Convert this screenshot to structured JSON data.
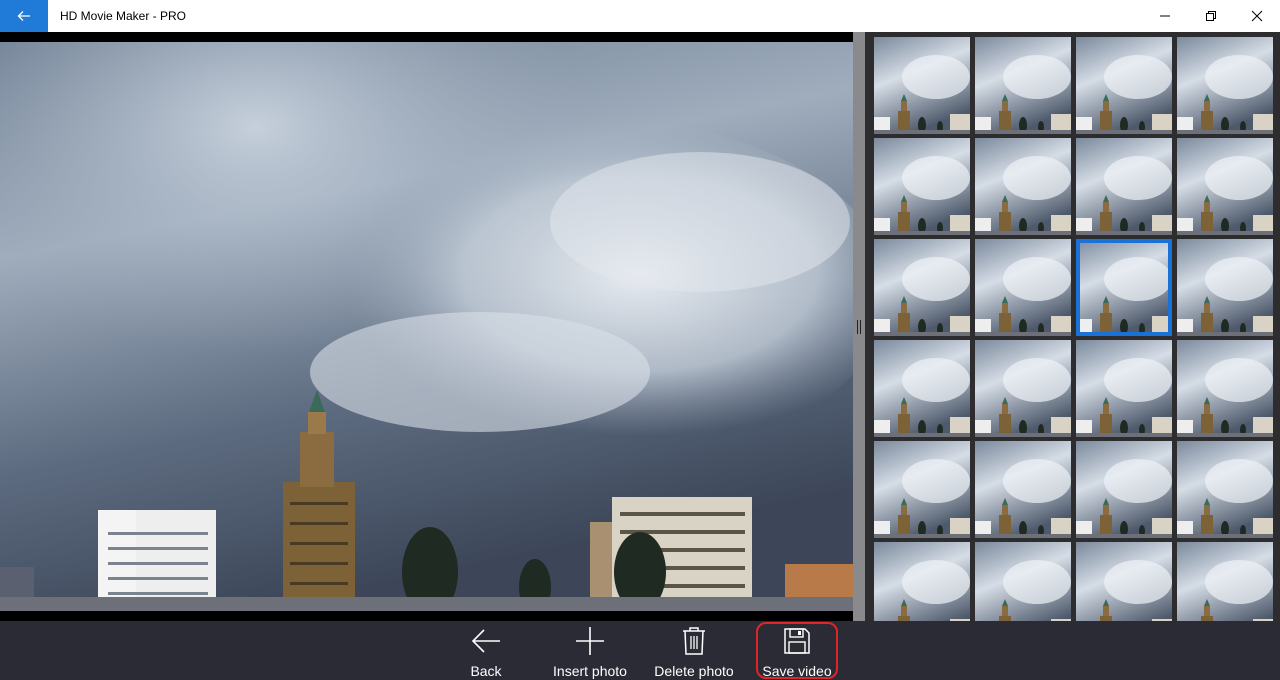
{
  "window": {
    "title": "HD Movie Maker - PRO",
    "back_icon": "arrow-left-icon",
    "minimize_icon": "minimize-icon",
    "maximize_icon": "restore-icon",
    "close_icon": "close-icon"
  },
  "preview": {
    "image": "cityscape-cloudy-sky-photo"
  },
  "thumbnails": {
    "count": 24,
    "selected_index": 10,
    "image": "cityscape-cloudy-sky-photo"
  },
  "toolbar": {
    "items": [
      {
        "label": "Back",
        "icon": "arrow-left-icon"
      },
      {
        "label": "Insert photo",
        "icon": "plus-icon"
      },
      {
        "label": "Delete photo",
        "icon": "trash-icon"
      },
      {
        "label": "Save video",
        "icon": "floppy-disk-icon"
      }
    ]
  },
  "colors": {
    "accent": "#1f7ad8",
    "toolbar_bg": "#2a2b34",
    "highlight": "#e0242a"
  }
}
